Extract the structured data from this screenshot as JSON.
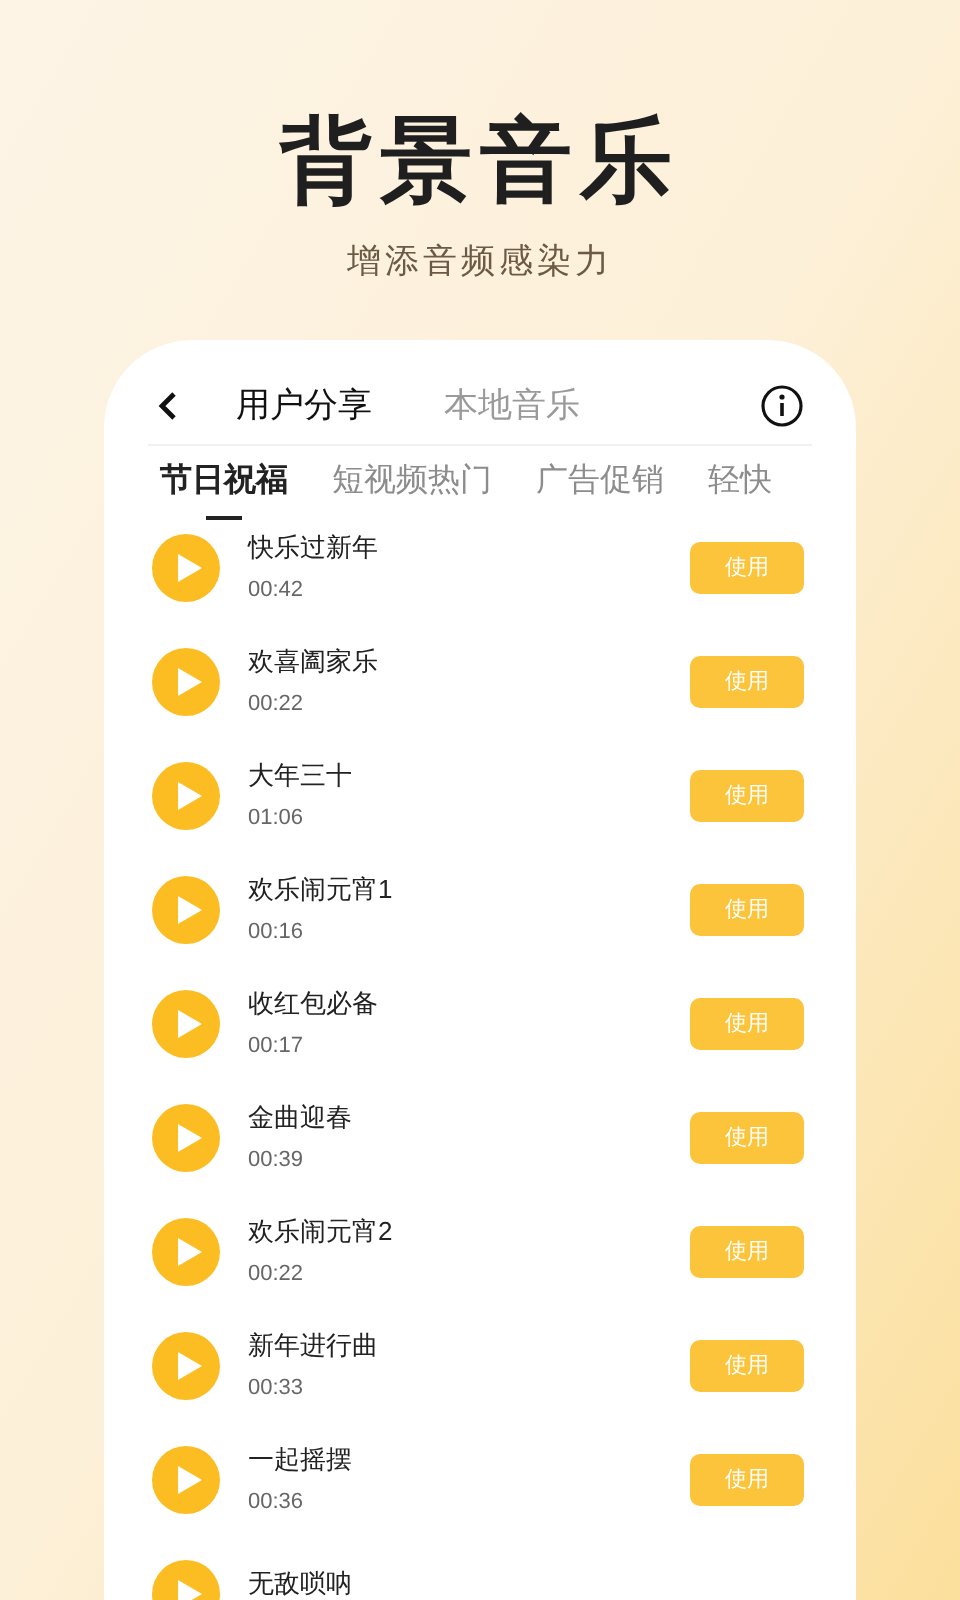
{
  "headline": "背景音乐",
  "subtitle": "增添音频感染力",
  "header": {
    "tabs": [
      {
        "label": "用户分享",
        "selected": true
      },
      {
        "label": "本地音乐",
        "selected": false
      }
    ]
  },
  "categories": [
    {
      "label": "节日祝福",
      "selected": true
    },
    {
      "label": "短视频热门",
      "selected": false
    },
    {
      "label": "广告促销",
      "selected": false
    },
    {
      "label": "轻快",
      "selected": false
    }
  ],
  "tracks": [
    {
      "title": "快乐过新年",
      "duration": "00:42",
      "button": "使用"
    },
    {
      "title": "欢喜阖家乐",
      "duration": "00:22",
      "button": "使用"
    },
    {
      "title": "大年三十",
      "duration": "01:06",
      "button": "使用"
    },
    {
      "title": "欢乐闹元宵1",
      "duration": "00:16",
      "button": "使用"
    },
    {
      "title": "收红包必备",
      "duration": "00:17",
      "button": "使用"
    },
    {
      "title": "金曲迎春",
      "duration": "00:39",
      "button": "使用"
    },
    {
      "title": "欢乐闹元宵2",
      "duration": "00:22",
      "button": "使用"
    },
    {
      "title": "新年进行曲",
      "duration": "00:33",
      "button": "使用"
    },
    {
      "title": "一起摇摆",
      "duration": "00:36",
      "button": "使用"
    },
    {
      "title": "无敌唢呐"
    }
  ]
}
